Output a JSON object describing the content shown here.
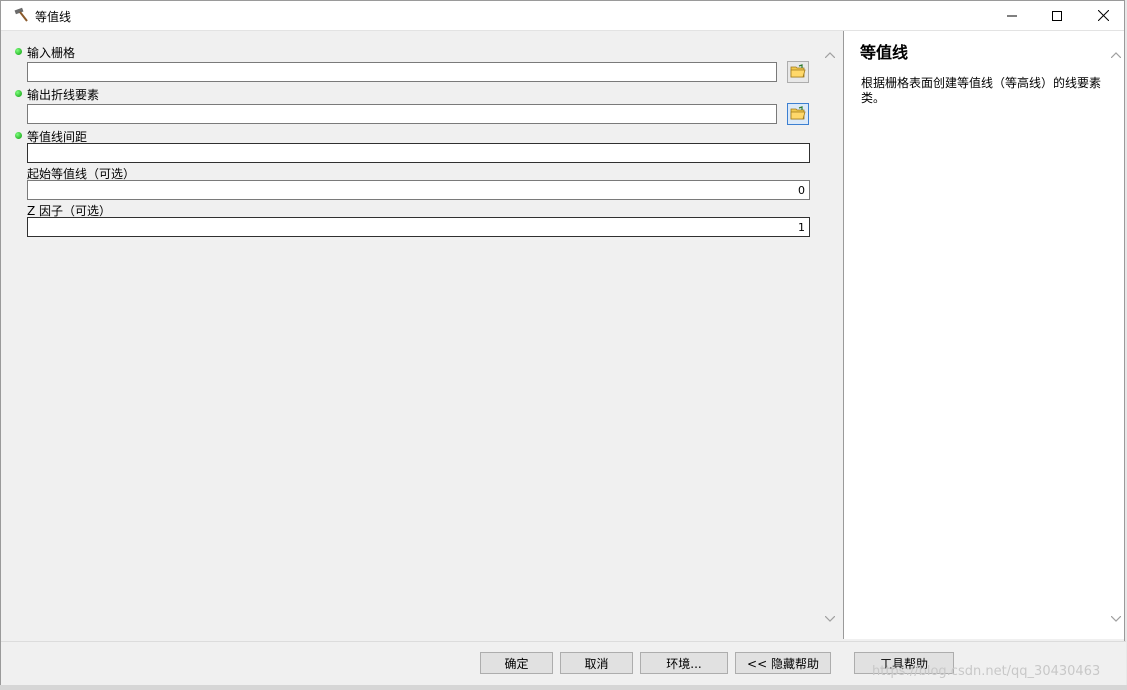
{
  "window": {
    "title": "等值线",
    "icon": "hammer-icon",
    "controls": [
      "minimize-icon",
      "maximize-icon",
      "close-icon"
    ]
  },
  "params": {
    "input_raster": {
      "label": "输入栅格",
      "value": "",
      "required": true
    },
    "output_features": {
      "label": "输出折线要素",
      "value": "",
      "required": true
    },
    "contour_interval": {
      "label": "等值线间距",
      "value": "",
      "required": true
    },
    "base_contour": {
      "label": "起始等值线（可选）",
      "value": "0",
      "required": false
    },
    "z_factor": {
      "label": "Z 因子（可选）",
      "value": "1",
      "required": false
    }
  },
  "help": {
    "title": "等值线",
    "description": "根据栅格表面创建等值线（等高线）的线要素类。"
  },
  "buttons": {
    "ok": "确定",
    "cancel": "取消",
    "environments": "环境...",
    "hide_help": "<< 隐藏帮助",
    "tool_help": "工具帮助"
  },
  "watermark": "https://blog.csdn.net/qq_30430463",
  "colors": {
    "required_dot": "#0a9a0a",
    "focus_border": "#3c7fd1"
  }
}
